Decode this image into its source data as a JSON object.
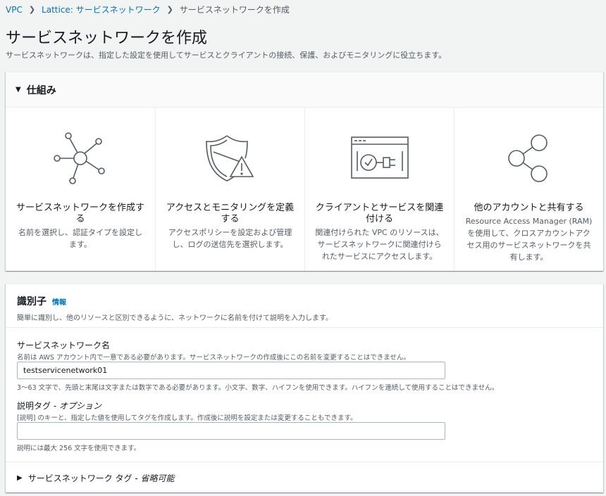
{
  "breadcrumb": [
    "VPC",
    "Lattice: サービスネットワーク",
    "サービスネットワークを作成"
  ],
  "page": {
    "title": "サービスネットワークを作成",
    "description": "サービスネットワークは、指定した設定を使用してサービスとクライアントの接続、保護、およびモニタリングに役立ちます。"
  },
  "how_it_works": {
    "title": "仕組み",
    "columns": [
      {
        "icon": "network-hub-icon",
        "title": "サービスネットワークを作成する",
        "desc": "名前を選択し、認証タイプを設定します。"
      },
      {
        "icon": "shield-warning-icon",
        "title": "アクセスとモニタリングを定義する",
        "desc": "アクセスポリシーを設定および管理し、ログの送信先を選択します。"
      },
      {
        "icon": "client-plug-icon",
        "title": "クライアントとサービスを関連付ける",
        "desc": "関連付けられた VPC のリソースは、サービスネットワークに関連付けられたサービスにアクセスします。"
      },
      {
        "icon": "share-icon",
        "title": "他のアカウントと共有する",
        "desc": "Resource Access Manager (RAM) を使用して、クロスアカウントアクセス用のサービスネットワークを共有します。"
      }
    ]
  },
  "identifier": {
    "title": "識別子",
    "info": "情報",
    "description": "簡単に識別し、他のリソースと区別できるように、ネットワークに名前を付けて説明を入力します。",
    "name_label": "サービスネットワーク名",
    "name_help": "名前は AWS アカウント内で一意である必要があります。サービスネットワークの作成後にこの名前を変更することはできません。",
    "name_value": "testservicenetwork01",
    "name_constraint": "3～63 文字で、先頭と末尾は文字または数字である必要があります。小文字、数字、ハイフンを使用できます。ハイフンを連続して使用することはできません。",
    "desc_label": "説明タグ",
    "desc_label_optional": "- オプション",
    "desc_help": "[説明] のキーと、指定した値を使用してタグを作成します。作成後に説明を設定または変更することもできます。",
    "desc_value": "",
    "desc_constraint": "説明には最大 256 文字を使用できます。"
  },
  "tags": {
    "label": "サービスネットワーク タグ",
    "optional": "- 省略可能"
  }
}
